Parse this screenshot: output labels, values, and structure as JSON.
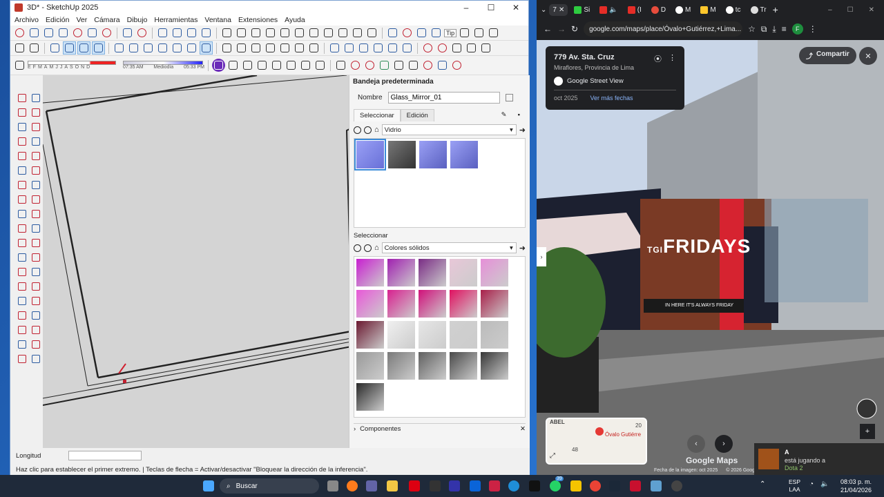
{
  "sketchup": {
    "title": "3D* - SketchUp 2025",
    "menu": [
      "Archivo",
      "Edición",
      "Ver",
      "Cámara",
      "Dibujo",
      "Herramientas",
      "Ventana",
      "Extensiones",
      "Ayuda"
    ],
    "tips_label": "Tip",
    "months": [
      "E",
      "F",
      "M",
      "A",
      "M",
      "J",
      "J",
      "A",
      "S",
      "O",
      "N",
      "D"
    ],
    "time_start": "07:35 AM",
    "time_mid": "Mediodía",
    "time_end": "05:33 PM",
    "tray": {
      "title": "Bandeja predeterminada",
      "name_label": "Nombre",
      "name_value": "Glass_Mirror_01",
      "tab_select": "Seleccionar",
      "tab_edit": "Edición",
      "library1": "Vidrio",
      "select_label": "Seleccionar",
      "library2": "Colores sólidos",
      "components": "Componentes"
    },
    "status_label": "Longitud",
    "status_hint": "Haz clic para establecer el primer extremo. | Teclas de flecha = Activar/desactivar \"Bloquear la dirección de la inferencia\"."
  },
  "chrome": {
    "tabs": [
      "7",
      "Si",
      "(I",
      "D",
      "M",
      "M",
      "tc",
      "Tr"
    ],
    "url": "google.com/maps/place/Óvalo+Gutiérrez,+Lima...",
    "profile": "F"
  },
  "streetview": {
    "address": "779 Av. Sta. Cruz",
    "locality": "Miraflores, Provincia de Lima",
    "source": "Google Street View",
    "date": "oct 2025",
    "more_dates": "Ver más fechas",
    "share": "Compartir",
    "sign": "FRIDAYS",
    "sign_left": "TGI",
    "slogan": "IN HERE IT'S ALWAYS FRIDAY",
    "minimap_label": "Óvalo Gutiérre",
    "minimap_street": "ABEL",
    "minimap_number": "48",
    "minimap_20": "20",
    "brand": "Google Maps",
    "image_date": "Fecha de la imagen: oct 2025",
    "copyright": "© 2026 Google"
  },
  "notification": {
    "user": "A",
    "line1": "está jugando a",
    "game": "Dota 2"
  },
  "taskbar": {
    "search": "Buscar",
    "lang1": "ESP",
    "lang2": "LAA",
    "time": "08:03 p. m.",
    "date": "21/04/2026",
    "badge": "39"
  },
  "colors": {
    "accent": "#3a8bd8",
    "sketchup_red": "#c02030",
    "taskbar": "#1f2a3a"
  }
}
